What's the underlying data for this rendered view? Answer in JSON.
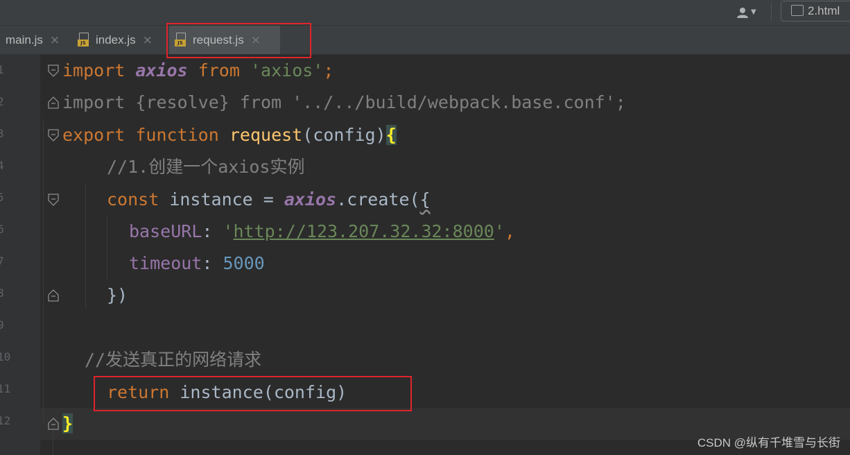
{
  "toolbar": {
    "user_icon": "user-icon",
    "run_config_label": "2.html",
    "run_config_icon": "html-config-icon"
  },
  "tabs": [
    {
      "label": "main.js",
      "close": "×",
      "icon": "js-file-icon"
    },
    {
      "label": "index.js",
      "close": "×",
      "icon": "js-file-icon"
    },
    {
      "label": "request.js",
      "close": "×",
      "icon": "js-file-icon",
      "active": true
    }
  ],
  "js_badge": "JS",
  "gutter": {
    "line_numbers": [
      "1",
      "2",
      "3",
      "4",
      "5",
      "6",
      "7",
      "8",
      "9",
      "10",
      "11",
      "12"
    ]
  },
  "code": {
    "line1": {
      "import": "import",
      "axios": "axios",
      "from": "from",
      "string": "'axios'",
      "semi": ";"
    },
    "line2": {
      "text": "import {resolve} from '../../build/webpack.base.conf';"
    },
    "line3": {
      "export": "export",
      "function": "function",
      "name": "request",
      "open": "(",
      "param": "config",
      "close": ")",
      "brace": "{"
    },
    "line4": {
      "comment": "//1.创建一个axios实例"
    },
    "line5": {
      "const": "const",
      "rest": " instance = ",
      "axios": "axios",
      "call": ".create(",
      "brace": "{"
    },
    "line6": {
      "key": "baseURL",
      "colon": ": ",
      "q1": "'",
      "url": "http://123.207.32.32:8000",
      "q2": "'",
      "comma": ","
    },
    "line7": {
      "key": "timeout",
      "colon": ": ",
      "value": "5000"
    },
    "line8": {
      "text": "})"
    },
    "line10": {
      "comment": "//发送真正的网络请求"
    },
    "line11": {
      "return": "return",
      "rest": " instance(config)"
    },
    "line12": {
      "brace": "}"
    }
  },
  "watermark": "CSDN @纵有千堆雪与长街",
  "colors": {
    "editor_bg": "#2b2b2b",
    "keyword": "#cc7832",
    "string": "#6a8759",
    "function": "#ffc66d",
    "comment": "#808080",
    "property": "#9876aa",
    "number": "#6897bb",
    "highlight_box": "#e0232c"
  }
}
